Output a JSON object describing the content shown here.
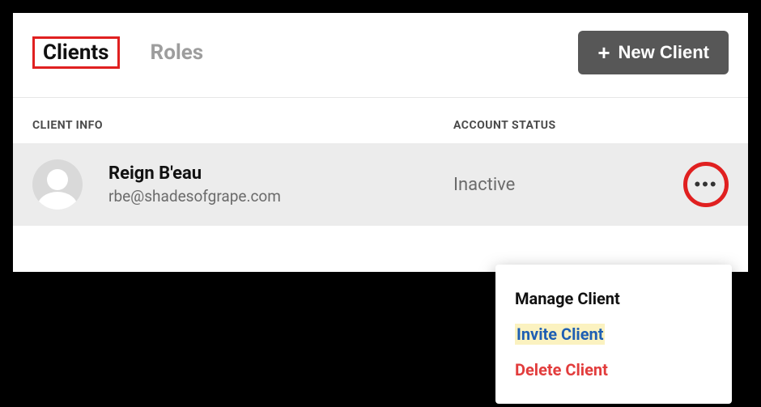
{
  "tabs": {
    "clients": "Clients",
    "roles": "Roles"
  },
  "newClientLabel": "New Client",
  "columns": {
    "info": "CLIENT INFO",
    "status": "ACCOUNT STATUS"
  },
  "client": {
    "name": "Reign B'eau",
    "email": "rbe@shadesofgrape.com",
    "status": "Inactive"
  },
  "menu": {
    "manage": "Manage Client",
    "invite": "Invite Client",
    "delete": "Delete Client"
  }
}
